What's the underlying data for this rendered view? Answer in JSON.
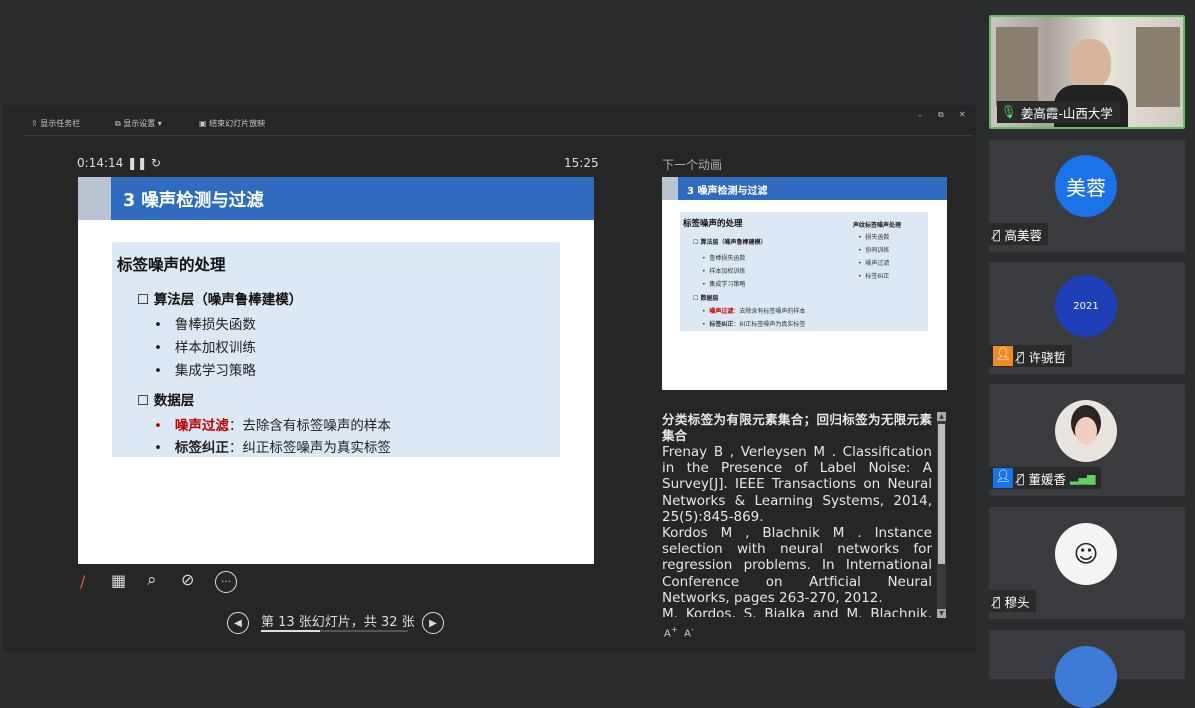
{
  "toolbar": {
    "taskbar": "显示任务栏",
    "display": "显示设置 ▾",
    "end": "结束幻灯片放映"
  },
  "presenter": {
    "elapsed": "0:14:14",
    "clock": "15:25",
    "next_label": "下一个动画",
    "slide_nav": "第 13 张幻灯片，共 32 张"
  },
  "slide": {
    "title": "3 噪声检测与过滤",
    "heading": "标签噪声的处理",
    "algo_layer": "算法层（噪声鲁棒建模）",
    "algo_items": [
      "鲁棒损失函数",
      "样本加权训练",
      "集成学习策略"
    ],
    "data_layer": "数据层",
    "data_items": [
      {
        "term": "噪声过滤",
        "desc": "：去除含有标签噪声的样本"
      },
      {
        "term": "标签纠正",
        "desc": "：纠正标签噪声为真实标签"
      }
    ]
  },
  "next_slide": {
    "title": "3 噪声检测与过滤",
    "heading": "标签噪声的处理",
    "right_title": "声纹标签噪声处理",
    "right_items": [
      "损失函数",
      "协同训练",
      "噪声过滤",
      "标签纠正"
    ]
  },
  "notes": {
    "bold": "分类标签为有限元素集合；回归标签为无限元素集合",
    "lines": [
      "Frenay B , Verleysen M . Classification in the Presence of Label Noise: A Survey[J]. IEEE Transactions on Neural Networks & Learning Systems, 2014, 25(5):845-869.",
      "Kordos M , Blachnik M . Instance selection with neural networks for regression problems. In International Conference on Artficial Neural Networks, pages 263-270, 2012.",
      "M. Kordos, S. Bialka and M. Blachnik, Instance selection in logical rule"
    ]
  },
  "participants": [
    {
      "name": "姜高霞-山西大学",
      "type": "video"
    },
    {
      "name": "高美蓉",
      "avatar_text": "美蓉",
      "type": "initials",
      "color": "#1a73e8"
    },
    {
      "name": "许骁哲",
      "type": "photo"
    },
    {
      "name": "董媛香",
      "type": "photo"
    },
    {
      "name": "穆头",
      "type": "cartoon"
    }
  ],
  "colors": {
    "accent": "#2f6cc0",
    "red": "#c00000"
  }
}
